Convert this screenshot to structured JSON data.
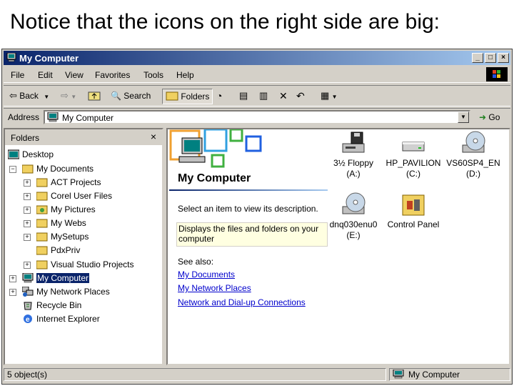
{
  "caption": "Notice that the icons on the right side are big:",
  "window": {
    "title": "My Computer",
    "min_glyph": "_",
    "max_glyph": "□",
    "close_glyph": "×"
  },
  "menu": [
    "File",
    "Edit",
    "View",
    "Favorites",
    "Tools",
    "Help"
  ],
  "toolbar": {
    "back_label": "Back",
    "search_label": "Search",
    "folders_label": "Folders"
  },
  "address": {
    "label": "Address",
    "value": "My Computer",
    "go_label": "Go"
  },
  "folders_pane": {
    "title": "Folders",
    "close_glyph": "×",
    "tree": [
      {
        "label": "Desktop"
      },
      {
        "label": "My Documents"
      },
      {
        "label": "ACT Projects"
      },
      {
        "label": "Corel User Files"
      },
      {
        "label": "My Pictures"
      },
      {
        "label": "My Webs"
      },
      {
        "label": "MySetups"
      },
      {
        "label": "PdxPriv"
      },
      {
        "label": "Visual Studio Projects"
      },
      {
        "label": "My Computer"
      },
      {
        "label": "My Network Places"
      },
      {
        "label": "Recycle Bin"
      },
      {
        "label": "Internet Explorer"
      }
    ]
  },
  "content": {
    "title": "My Computer",
    "select_prompt": "Select an item to view its description.",
    "tip": "Displays the files and folders on your computer",
    "see_also": "See also:",
    "links": [
      "My Documents",
      "My Network Places",
      "Network and Dial-up Connections"
    ],
    "drives": [
      {
        "name": "3½ Floppy",
        "letter": "(A:)",
        "icon": "floppy-drive-icon"
      },
      {
        "name": "HP_PAVILION",
        "letter": "(C:)",
        "icon": "hard-drive-icon"
      },
      {
        "name": "VS60SP4_EN",
        "letter": "(D:)",
        "icon": "cd-drive-icon"
      },
      {
        "name": "dnq030enu0",
        "letter": "(E:)",
        "icon": "cd-drive-icon"
      },
      {
        "name": "Control Panel",
        "letter": "",
        "icon": "control-panel-icon"
      }
    ]
  },
  "status": {
    "left": "5 object(s)",
    "right": "My Computer"
  },
  "colors": {
    "title_bar": "#0a246a",
    "chrome": "#d4d0c8",
    "link": "#0000cc",
    "tooltip_bg": "#ffffe1"
  }
}
